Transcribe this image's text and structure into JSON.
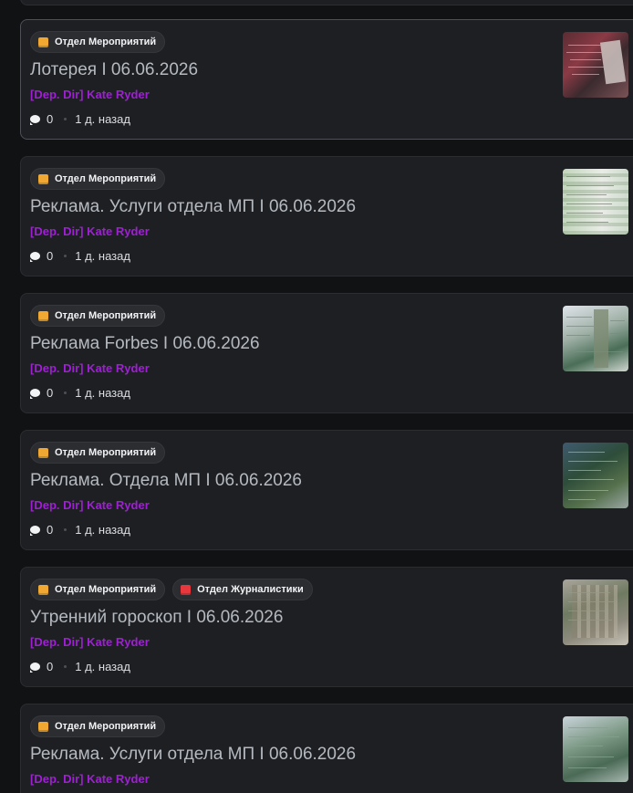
{
  "colors": {
    "author": "#a01fd6",
    "tag_events": "#f0a832",
    "tag_journalism": "#e8383d"
  },
  "icons": {
    "comment": "speech-bubble-icon",
    "tag_events": "orange-square-icon",
    "tag_journalism": "red-book-icon"
  },
  "posts": [
    {
      "tags": [
        "Отдел Мероприятий"
      ],
      "title": "Лотерея I 06.06.2026",
      "author": "[Dep. Dir] Kate Ryder",
      "comments": "0",
      "time": "1 д. назад"
    },
    {
      "tags": [
        "Отдел Мероприятий"
      ],
      "title": "Реклама. Услуги отдела МП I 06.06.2026",
      "author": "[Dep. Dir] Kate Ryder",
      "comments": "0",
      "time": "1 д. назад"
    },
    {
      "tags": [
        "Отдел Мероприятий"
      ],
      "title": "Реклама Forbes I 06.06.2026",
      "author": "[Dep. Dir] Kate Ryder",
      "comments": "0",
      "time": "1 д. назад"
    },
    {
      "tags": [
        "Отдел Мероприятий"
      ],
      "title": "Реклама. Отдела МП I 06.06.2026",
      "author": "[Dep. Dir] Kate Ryder",
      "comments": "0",
      "time": "1 д. назад"
    },
    {
      "tags": [
        "Отдел Мероприятий",
        "Отдел Журналистики"
      ],
      "title": "Утренний гороскоп I 06.06.2026",
      "author": "[Dep. Dir] Kate Ryder",
      "comments": "0",
      "time": "1 д. назад"
    },
    {
      "tags": [
        "Отдел Мероприятий"
      ],
      "title": "Реклама. Услуги отдела МП I 06.06.2026",
      "author": "[Dep. Dir] Kate Ryder",
      "comments": "",
      "time": ""
    }
  ]
}
